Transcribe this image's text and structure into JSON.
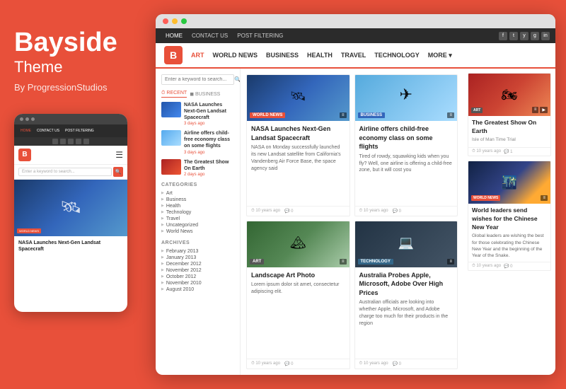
{
  "brand": {
    "title": "Bayside",
    "subtitle": "Theme",
    "by": "By ProgressionStudios"
  },
  "desktop": {
    "titlebar": {
      "dots": [
        "red",
        "yellow",
        "green"
      ]
    },
    "topnav": {
      "items": [
        "HOME",
        "CONTACT US",
        "POST FILTERING"
      ],
      "socials": [
        "f",
        "t",
        "y",
        "g",
        "in"
      ]
    },
    "logobar": {
      "logo_letter": "B",
      "categories": [
        "ART",
        "WORLD NEWS",
        "BUSINESS",
        "HEALTH",
        "TRAVEL",
        "TECHNOLOGY",
        "MORE +"
      ]
    },
    "sidebar": {
      "search_placeholder": "Enter a keyword to search...",
      "tabs": [
        "RECENT",
        "BUSINESS"
      ],
      "recent_items": [
        {
          "title": "NASA Launches Next-Gen Landsat Spacecraft",
          "date": "3 days ago",
          "thumb_type": "blue"
        },
        {
          "title": "Airline offers child-free economy class on some flights",
          "date": "3 days ago",
          "thumb_type": "sky"
        },
        {
          "title": "The Greatest Show On Earth",
          "date": "2 days ago",
          "thumb_type": "moto"
        }
      ],
      "categories_title": "CATEGORIES",
      "categories": [
        "Art",
        "Business",
        "Health",
        "Technology",
        "Travel",
        "Uncategorized",
        "World News"
      ],
      "archives_title": "ARCHIVES",
      "archives": [
        "February 2013",
        "January 2013",
        "December 2012",
        "November 2012",
        "October 2012",
        "November 2010",
        "August 2010"
      ]
    },
    "articles": [
      {
        "id": "nasa",
        "badge": "WORLD NEWS",
        "badge_type": "red",
        "thumb_type": "blue",
        "thumb_icon": "🛰",
        "title": "NASA Launches Next-Gen Landsat Spacecraft",
        "excerpt": "NASA on Monday successfully launched its new Landsat satellite from California's Vandenberg Air Force Base, the space agency said",
        "time": "10 years ago",
        "comments": "0"
      },
      {
        "id": "airline",
        "badge": "BUSINESS",
        "badge_type": "blue",
        "thumb_type": "sky",
        "thumb_icon": "✈",
        "title": "Airline offers child-free economy class on some flights",
        "excerpt": "Tired of rowdy, squawking kids when you fly? Well, one airline is offering a child-free zone, but it will cost you",
        "time": "10 years ago",
        "comments": "0"
      },
      {
        "id": "landscape",
        "badge": "ART",
        "badge_type": "gray",
        "thumb_type": "green",
        "thumb_icon": "🏔",
        "title": "Landscape Art Photo",
        "excerpt": "Lorem ipsum dolor sit amet, consectetur adipiscing elit.",
        "time": "10 years ago",
        "comments": "0"
      },
      {
        "id": "australia",
        "badge": "TECHNOLOGY",
        "badge_type": "teal",
        "thumb_type": "dark",
        "thumb_icon": "💻",
        "title": "Australia Probes Apple, Microsoft, Adobe Over High Prices",
        "excerpt": "Australian officials are looking into whether Apple, Microsoft, and Adobe charge too much for their products in the region",
        "time": "10 years ago",
        "comments": "0"
      }
    ],
    "right_articles": [
      {
        "id": "greatest-show",
        "badge": "ART",
        "badge_extra": "📹",
        "thumb_type": "moto",
        "thumb_icon": "🏍",
        "title": "The Greatest Show On Earth",
        "subtitle": "Isle of Man Time Trial",
        "time": "10 years ago",
        "comments": "1"
      },
      {
        "id": "chinese-new-year",
        "badge": "WORLD NEWS",
        "thumb_type": "city",
        "thumb_icon": "🌃",
        "title": "World leaders send wishes for the Chinese New Year",
        "excerpt": "Global leaders are wishing the best for those celebrating the Chinese New Year and the beginning of the Year of the Snake.",
        "time": "10 years ago",
        "comments": "0"
      }
    ]
  },
  "mobile": {
    "nav_items": [
      "HOME",
      "CONTACT US",
      "POST FILTERING"
    ],
    "logo_letter": "B",
    "search_placeholder": "Enter a keyword to search...",
    "hero_badge": "WORLD NEWS",
    "article_title": "NASA Launches Next-Gen Landsat Spacecraft"
  }
}
